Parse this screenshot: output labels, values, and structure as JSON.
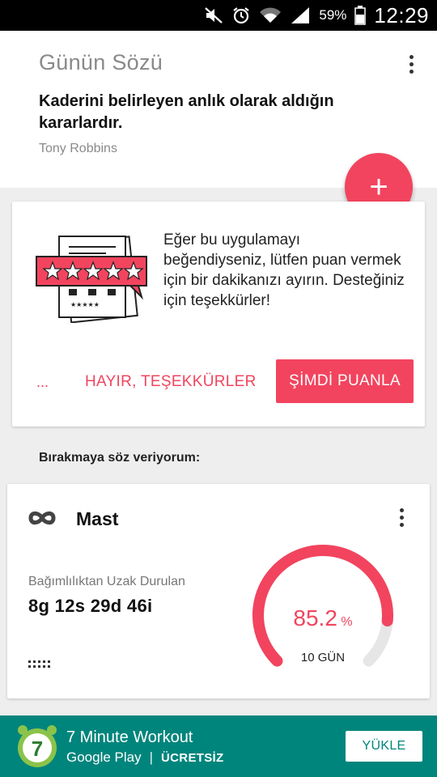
{
  "status_bar": {
    "battery_percent": "59%",
    "time": "12:29",
    "icons": [
      "mute-icon",
      "alarm-icon",
      "wifi-icon",
      "signal-icon",
      "battery-icon"
    ]
  },
  "quote": {
    "title": "Günün Sözü",
    "text": "Kaderini belirleyen anlık olarak aldığın kararlardır.",
    "author": "Tony Robbins"
  },
  "fab": {
    "label": "+"
  },
  "rate_card": {
    "message": "Eğer bu uygulamayı beğendiyseniz, lütfen puan vermek için bir dakikanızı ayırın. Desteğiniz için teşekkürler!",
    "ellipsis": "...",
    "decline_label": "HAYIR, TEŞEKKÜRLER",
    "accept_label": "ŞİMDİ PUANLA",
    "accent_color": "#f2445e"
  },
  "section_label": "Bırakmaya söz veriyorum:",
  "habit": {
    "name": "Mast",
    "subtitle": "Bağımlılıktan Uzak Durulan",
    "duration": "8g 12s 29d 46i",
    "percent_value": "85.2",
    "percent_unit": "%",
    "progress_fraction": 0.852,
    "days_label": "10 GÜN"
  },
  "ad": {
    "title": "7 Minute Workout",
    "store": "Google Play",
    "separator": "|",
    "price": "ÜCRETSİZ",
    "install_label": "YÜKLE",
    "logo_text": "7",
    "background_color": "#00857c"
  }
}
